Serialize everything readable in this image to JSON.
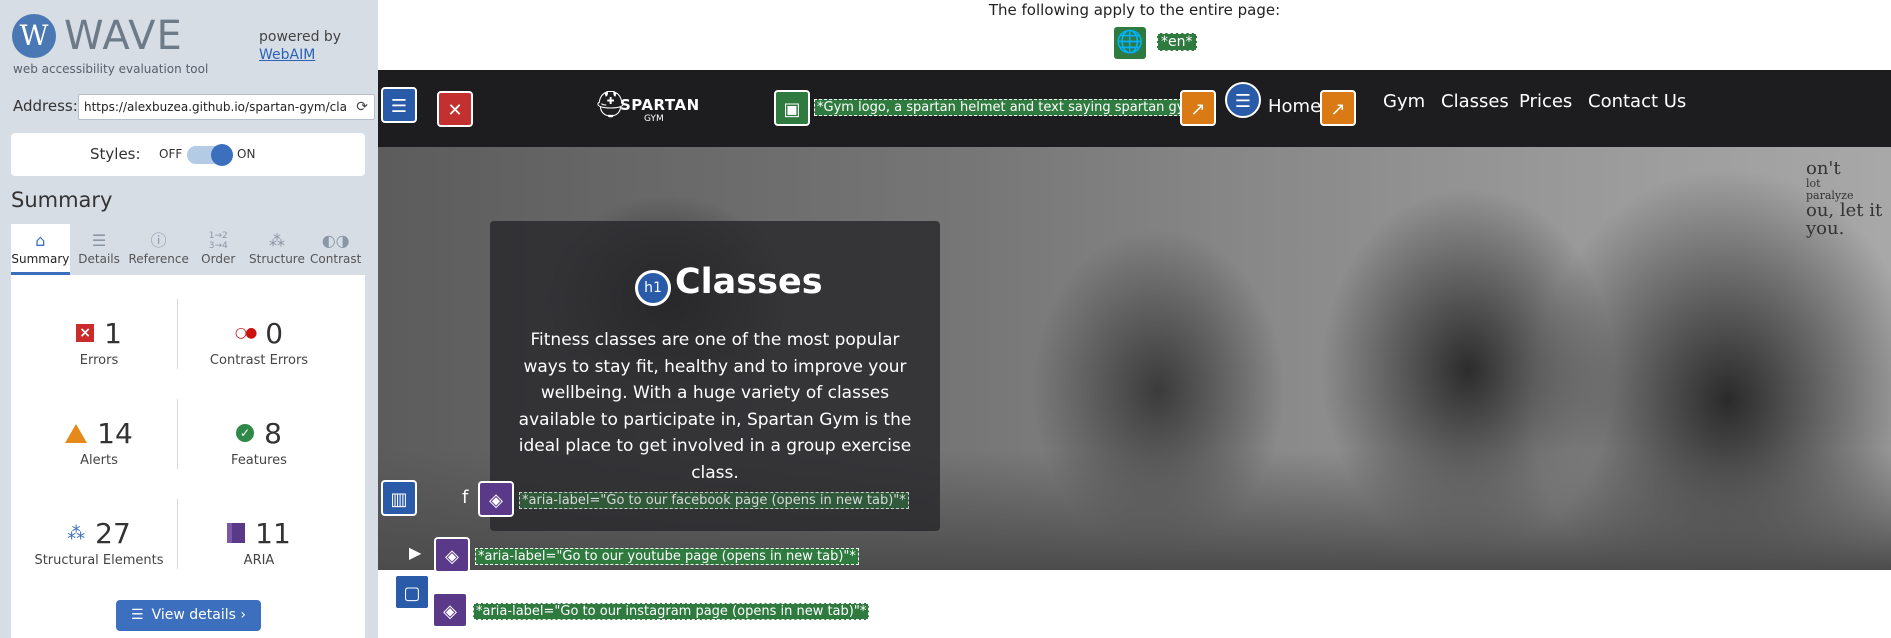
{
  "wave": {
    "logo_letter": "W",
    "logo_word": "WAVE",
    "logo_sub": "web accessibility evaluation tool",
    "powered_by": "powered by",
    "webaim_link": "WebAIM",
    "address_label": "Address:",
    "address_value": "https://alexbuzea.github.io/spartan-gym/cla",
    "styles_label": "Styles:",
    "styles_off": "OFF",
    "styles_on": "ON",
    "summary_title": "Summary",
    "tabs": [
      {
        "label": "Summary",
        "icon": "home-icon",
        "active": true
      },
      {
        "label": "Details",
        "icon": "list-icon",
        "active": false
      },
      {
        "label": "Reference",
        "icon": "info-icon",
        "active": false
      },
      {
        "label": "Order",
        "icon": "order-icon",
        "active": false
      },
      {
        "label": "Structure",
        "icon": "structure-icon",
        "active": false
      },
      {
        "label": "Contrast",
        "icon": "contrast-icon",
        "active": false
      }
    ],
    "stats": {
      "errors": {
        "value": "1",
        "label": "Errors"
      },
      "contrast_errors": {
        "value": "0",
        "label": "Contrast Errors"
      },
      "alerts": {
        "value": "14",
        "label": "Alerts"
      },
      "features": {
        "value": "8",
        "label": "Features"
      },
      "structural": {
        "value": "27",
        "label": "Structural Elements"
      },
      "aria": {
        "value": "11",
        "label": "ARIA"
      }
    },
    "view_details": "View details ›",
    "colors": {
      "accent": "#3c6fbd",
      "error": "#cc2b2b",
      "alert": "#e58a1a",
      "feature": "#2f8a4a",
      "aria": "#5a3a88"
    }
  },
  "page": {
    "note": "The following apply to the entire page:",
    "lang_label": "*en*",
    "brand_name": "SPARTAN",
    "brand_sub": "GYM",
    "logo_alt_label": "*Gym logo, a spartan helmet and text saying spartan gym*",
    "nav": [
      "Home",
      "Gym",
      "Classes",
      "Prices",
      "Contact Us"
    ],
    "wall_text": [
      "on't",
      "lot",
      "paralyze",
      "ou, let it",
      "you."
    ],
    "h1_badge": "h1",
    "hero_title": "Classes",
    "hero_text": "Fitness classes are one of the most popular ways to stay fit, healthy and to improve your wellbeing. With a huge variety of classes available to participate in, Spartan Gym is the ideal place to get involved in a group exercise class.",
    "social": {
      "facebook_label": "*aria-label=\"Go to our facebook page (opens in new tab)\"*",
      "youtube_label": "*aria-label=\"Go to our youtube page (opens in new tab)\"*",
      "instagram_label": "*aria-label=\"Go to our instagram page (opens in new tab)\"*"
    }
  }
}
